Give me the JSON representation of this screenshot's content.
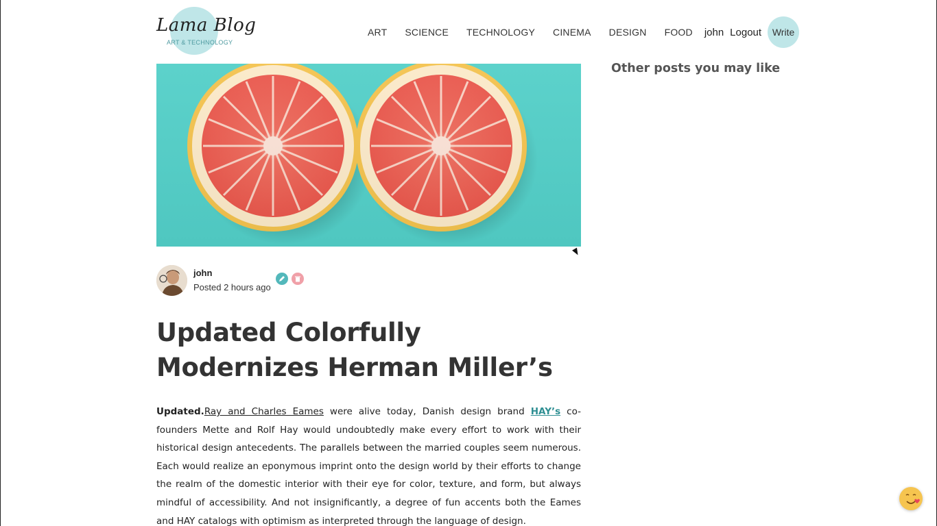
{
  "header": {
    "logo_title": "Lama Blog",
    "logo_subtitle": "ART & TECHNOLOGY",
    "nav": [
      "ART",
      "SCIENCE",
      "TECHNOLOGY",
      "CINEMA",
      "DESIGN",
      "FOOD"
    ],
    "username": "john",
    "logout_label": "Logout",
    "write_label": "Write"
  },
  "post": {
    "author": "john",
    "posted": "Posted 2 hours ago",
    "title": "Updated Colorfully Modernizes Herman Miller’s",
    "body_lead": "Updated.",
    "body_link1": "Ray and Charles Eames",
    "body_mid1": " were alive today, Danish design brand ",
    "body_link2": "HAY’s",
    "body_rest": " co-founders Mette and Rolf Hay would undoubtedly make every effort to work with their historical design antecedents. The parallels between the married couples seem numerous. Each would realize an eponymous imprint onto the design world by their efforts to change the realm of the domestic interior with their eye for color, texture, and form, but always mindful of accessibility. And not insignificantly, a degree of fun accents both the Eames and HAY catalogs with optimism as interpreted through the language of design."
  },
  "sidebar": {
    "title": "Other posts you may like"
  },
  "colors": {
    "accent": "#bfe6e8",
    "hero_background": "#52cfc8",
    "edit_icon": "#53b8bb",
    "delete_icon": "#f0a0a8",
    "link_hay": "#2f8f93"
  },
  "icons": {
    "edit": "pencil-edit-icon",
    "delete": "trash-icon",
    "floating": "emoji-icon"
  }
}
